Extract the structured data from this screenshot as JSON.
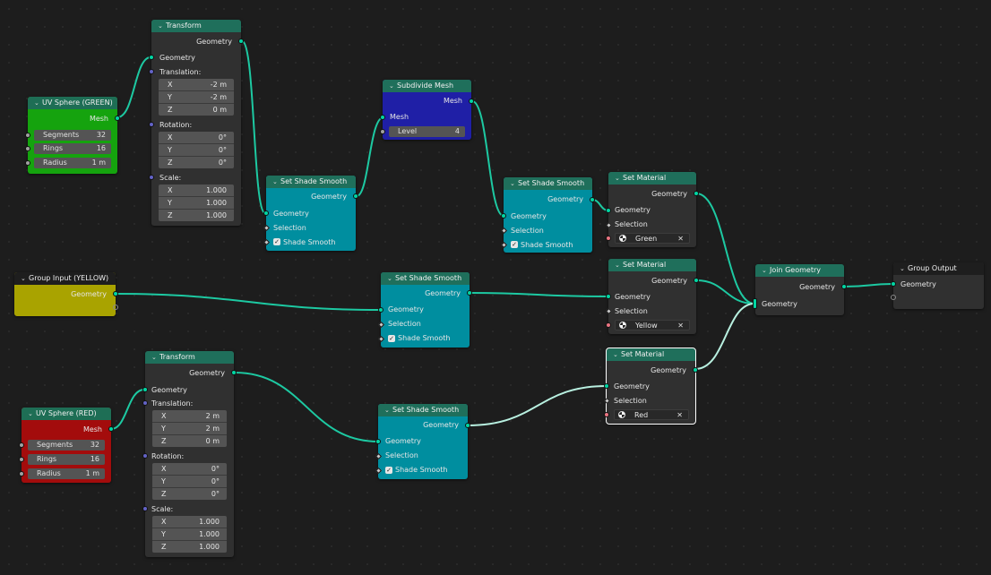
{
  "colors": {
    "geometry_socket": "#00d6a3",
    "vector_socket": "#6363c7",
    "material_socket": "#eb7582",
    "wire": "#1dc9a2",
    "wire_selected": "#b8f0e0",
    "node_body": "#303030",
    "header_geometry": "#1f6f5b",
    "green_body": "#15a30e",
    "yellow_body": "#a9a300",
    "red_body": "#a30c0c",
    "blue_body": "#1f1fa6",
    "cyan_body": "#008e9f"
  },
  "nodes": {
    "uv_green": {
      "title": "UV Sphere (GREEN)",
      "out": "Mesh",
      "fields": [
        {
          "label": "Segments",
          "value": "32"
        },
        {
          "label": "Rings",
          "value": "16"
        },
        {
          "label": "Radius",
          "value": "1 m"
        }
      ]
    },
    "transform1": {
      "title": "Transform",
      "out": "Geometry",
      "in": "Geometry",
      "translation_label": "Translation:",
      "rotation_label": "Rotation:",
      "scale_label": "Scale:",
      "translation": [
        {
          "axis": "X",
          "value": "-2 m"
        },
        {
          "axis": "Y",
          "value": "-2 m"
        },
        {
          "axis": "Z",
          "value": "0 m"
        }
      ],
      "rotation": [
        {
          "axis": "X",
          "value": "0°"
        },
        {
          "axis": "Y",
          "value": "0°"
        },
        {
          "axis": "Z",
          "value": "0°"
        }
      ],
      "scale": [
        {
          "axis": "X",
          "value": "1.000"
        },
        {
          "axis": "Y",
          "value": "1.000"
        },
        {
          "axis": "Z",
          "value": "1.000"
        }
      ]
    },
    "shade1": {
      "title": "Set Shade Smooth",
      "out": "Geometry",
      "in": "Geometry",
      "selection": "Selection",
      "smooth": "Shade Smooth"
    },
    "subdivide": {
      "title": "Subdivide Mesh",
      "out": "Mesh",
      "in": "Mesh",
      "level_label": "Level",
      "level_value": "4"
    },
    "shade2": {
      "title": "Set Shade Smooth",
      "out": "Geometry",
      "in": "Geometry",
      "selection": "Selection",
      "smooth": "Shade Smooth"
    },
    "mat_green": {
      "title": "Set Material",
      "out": "Geometry",
      "in": "Geometry",
      "selection": "Selection",
      "material": "Green"
    },
    "group_input": {
      "title": "Group Input (YELLOW)",
      "out": "Geometry"
    },
    "shade3": {
      "title": "Set Shade Smooth",
      "out": "Geometry",
      "in": "Geometry",
      "selection": "Selection",
      "smooth": "Shade Smooth"
    },
    "mat_yellow": {
      "title": "Set Material",
      "out": "Geometry",
      "in": "Geometry",
      "selection": "Selection",
      "material": "Yellow"
    },
    "join": {
      "title": "Join Geometry",
      "out": "Geometry",
      "in": "Geometry"
    },
    "group_output": {
      "title": "Group Output",
      "in": "Geometry"
    },
    "transform2": {
      "title": "Transform",
      "out": "Geometry",
      "in": "Geometry",
      "translation_label": "Translation:",
      "rotation_label": "Rotation:",
      "scale_label": "Scale:",
      "translation": [
        {
          "axis": "X",
          "value": "2 m"
        },
        {
          "axis": "Y",
          "value": "2 m"
        },
        {
          "axis": "Z",
          "value": "0 m"
        }
      ],
      "rotation": [
        {
          "axis": "X",
          "value": "0°"
        },
        {
          "axis": "Y",
          "value": "0°"
        },
        {
          "axis": "Z",
          "value": "0°"
        }
      ],
      "scale": [
        {
          "axis": "X",
          "value": "1.000"
        },
        {
          "axis": "Y",
          "value": "1.000"
        },
        {
          "axis": "Z",
          "value": "1.000"
        }
      ]
    },
    "uv_red": {
      "title": "UV Sphere (RED)",
      "out": "Mesh",
      "fields": [
        {
          "label": "Segments",
          "value": "32"
        },
        {
          "label": "Rings",
          "value": "16"
        },
        {
          "label": "Radius",
          "value": "1 m"
        }
      ]
    },
    "shade4": {
      "title": "Set Shade Smooth",
      "out": "Geometry",
      "in": "Geometry",
      "selection": "Selection",
      "smooth": "Shade Smooth"
    },
    "mat_red": {
      "title": "Set Material",
      "out": "Geometry",
      "in": "Geometry",
      "selection": "Selection",
      "material": "Red"
    }
  }
}
